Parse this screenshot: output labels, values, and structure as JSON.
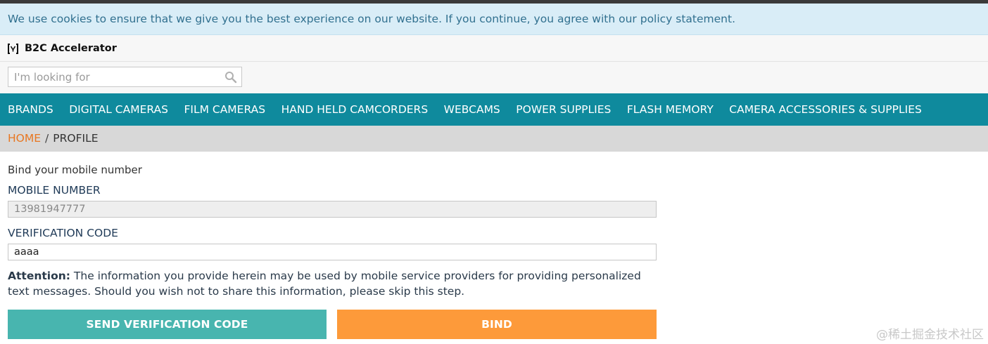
{
  "cookie_notice": {
    "text": "We use cookies to ensure that we give you the best experience on our website. If you continue, you agree with our policy statement."
  },
  "header": {
    "logo_icon": "store-logo-icon",
    "brand_name": "B2C Accelerator"
  },
  "search": {
    "placeholder": "I'm looking for",
    "value": "",
    "icon": "search-icon"
  },
  "nav": {
    "items": [
      {
        "label": "BRANDS"
      },
      {
        "label": "DIGITAL CAMERAS"
      },
      {
        "label": "FILM CAMERAS"
      },
      {
        "label": "HAND HELD CAMCORDERS"
      },
      {
        "label": "WEBCAMS"
      },
      {
        "label": "POWER SUPPLIES"
      },
      {
        "label": "FLASH MEMORY"
      },
      {
        "label": "CAMERA ACCESSORIES & SUPPLIES"
      }
    ]
  },
  "breadcrumb": {
    "home": "HOME",
    "separator": "/",
    "current": "PROFILE"
  },
  "form": {
    "intro": "Bind your mobile number",
    "mobile_label": "MOBILE NUMBER",
    "mobile_value": "13981947777",
    "code_label": "VERIFICATION CODE",
    "code_value": "aaaa",
    "attention_label": "Attention:",
    "attention_text": " The information you provide herein may be used by mobile service providers for providing personalized text messages. Should you wish not to share this information, please skip this step.",
    "send_button": "SEND VERIFICATION CODE",
    "bind_button": "BIND"
  },
  "watermark": "@稀土掘金技术社区",
  "colors": {
    "cookie_bg": "#d9edf7",
    "nav_bg": "#0f8a9d",
    "breadcrumb_home": "#e87722",
    "send_button": "#48b5af",
    "bind_button": "#fd9a3a"
  }
}
